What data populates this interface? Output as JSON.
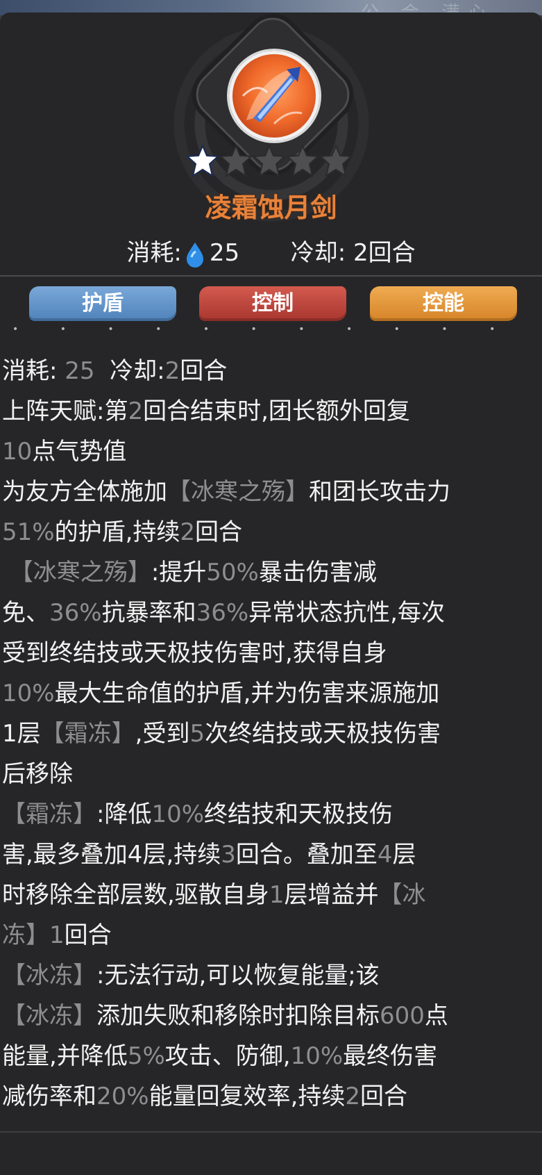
{
  "top_strip": {
    "ghost_text": "公 会 满心"
  },
  "skill": {
    "name": "凌霜蚀月剑",
    "icon": "ice-sword-emblem-icon",
    "stars_filled": 1,
    "stars_total": 5,
    "cost_label": "消耗:",
    "cost_value": "25",
    "cooldown": "冷却: 2回合"
  },
  "tags": [
    "护盾",
    "控制",
    "控能"
  ],
  "description": {
    "line1": {
      "a": "消耗:",
      "b": "25",
      "c": "冷却:",
      "d": "2",
      "e": "回合"
    },
    "line2": {
      "a": "上阵天赋:第",
      "b": "2",
      "c": "回合结束时,团长额外回复"
    },
    "line3": {
      "a": "10",
      "b": "点气势值"
    },
    "line4": {
      "a": "为友方全体施加",
      "b": "【冰寒之殇】",
      "c": "和团长攻击力"
    },
    "line5": {
      "a": "51%",
      "b": "的护盾,持续",
      "c": "2",
      "d": "回合"
    },
    "line6": {
      "a": "【冰寒之殇】",
      "b": ":提升",
      "c": "50%",
      "d": "暴击伤害减"
    },
    "line7": {
      "a": "免、",
      "b": "36%",
      "c": "抗暴率和",
      "d": "36%",
      "e": "异常状态抗性,每次"
    },
    "line8": {
      "a": "受到终结技或天极技伤害时,获得自身"
    },
    "line9": {
      "a": "10%",
      "b": "最大生命值的护盾,并为伤害来源施加"
    },
    "line10": {
      "a": "1层",
      "b": "【霜冻】",
      "c": ",受到",
      "d": "5",
      "e": "次终结技或天极技伤害"
    },
    "line11": {
      "a": "后移除"
    },
    "line12": {
      "a": "【霜冻】",
      "b": ":降低",
      "c": "10%",
      "d": "终结技和天极技伤"
    },
    "line13": {
      "a": "害,最多叠加4层,持续",
      "b": "3",
      "c": "回合。叠加至",
      "d": "4",
      "e": "层"
    },
    "line14": {
      "a": "时移除全部层数,驱散自身",
      "b": "1",
      "c": "层增益并",
      "d": "【冰"
    },
    "line15": {
      "a": "冻】",
      "b": "1",
      "c": "回合"
    },
    "line16": {
      "a": "【冰冻】",
      "b": ":无法行动,可以恢复能量;该"
    },
    "line17": {
      "a": "【冰冻】",
      "b": "添加失败和移除时扣除目标",
      "c": "600",
      "d": "点"
    },
    "line18": {
      "a": "能量,并降低",
      "b": "5%",
      "c": "攻击、防御,",
      "d": "10%",
      "e": "最终伤害"
    },
    "line19": {
      "a": "减伤率和",
      "b": "20%",
      "c": "能量回复效率,持续",
      "d": "2",
      "e": "回合"
    }
  },
  "colors": {
    "highlight_gray": "#8e8e90",
    "skill_name": "#e8823a",
    "tag_blue": "#5b8cc4",
    "tag_red": "#b8423a",
    "tag_orange": "#e0922f"
  }
}
